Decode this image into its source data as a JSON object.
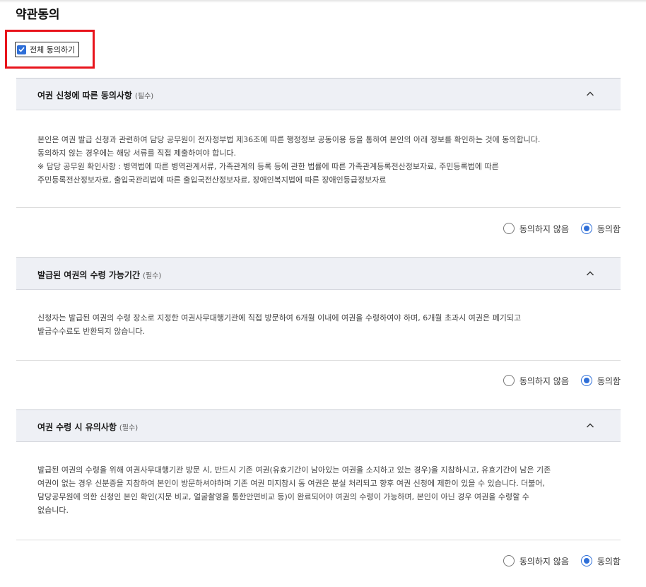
{
  "page": {
    "title": "약관동의"
  },
  "agree_all": {
    "label": "전체 동의하기",
    "checked": true
  },
  "colors": {
    "accent": "#2f6fd8",
    "highlight": "#e8141c",
    "header_bg": "#eef0f5"
  },
  "sections": [
    {
      "title": "여권 신청에 따른 동의사항",
      "required": "(필수)",
      "lines": [
        "본인은 여권 발급 신청과 관련하여 담당 공무원이 전자정부법 제36조에 따른 행정정보 공동이용 등을 통하여 본인의 아래 정보를 확인하는 것에 동의합니다.",
        "동의하지 않는 경우에는 해당 서류를 직접 제출하여야 합니다.",
        "※ 담당 공무원 확인사항 : 병역법에 따른 병역관계서류, 가족관계의 등록 등에 관한 법률에 따른 가족관계등록전산정보자료, 주민등록법에 따른",
        "주민등록전산정보자료, 출입국관리법에 따른 출입국전산정보자료, 장애인복지법에 따른 장애인등급정보자료"
      ],
      "disagree_label": "동의하지 않음",
      "agree_label": "동의함",
      "selected": "agree"
    },
    {
      "title": "발급된 여권의 수령 가능기간",
      "required": "(필수)",
      "lines": [
        "신청자는 발급된 여권의 수령 장소로 지정한 여권사무대행기관에 직접 방문하여 6개월 이내에 여권을 수령하여야 하며, 6개월 초과시 여권은 폐기되고",
        "발급수수료도 반환되지 않습니다."
      ],
      "disagree_label": "동의하지 않음",
      "agree_label": "동의함",
      "selected": "agree"
    },
    {
      "title": "여권 수령 시 유의사항",
      "required": "(필수)",
      "lines": [
        "발급된 여권의 수령을 위해 여권사무대행기관 방문 시, 반드시 기존 여권(유효기간이 남아있는 여권을 소지하고 있는 경우)을 지참하시고, 유효기간이 남은 기존",
        "여권이 없는 경우 신분증을 지참하여 본인이 방문하셔야하며 기존 여권 미지참시 동 여권은 분실 처리되고 향후 여권 신청에 제한이 있을 수 있습니다. 더불어,",
        "담당공무원에 의한 신청인 본인 확인(지문 비교, 얼굴촬영을 통한안면비교 등)이 완료되어야 여권의 수령이 가능하며, 본인이 아닌 경우 여권을 수령할 수",
        "없습니다."
      ],
      "disagree_label": "동의하지 않음",
      "agree_label": "동의함",
      "selected": "agree"
    }
  ]
}
